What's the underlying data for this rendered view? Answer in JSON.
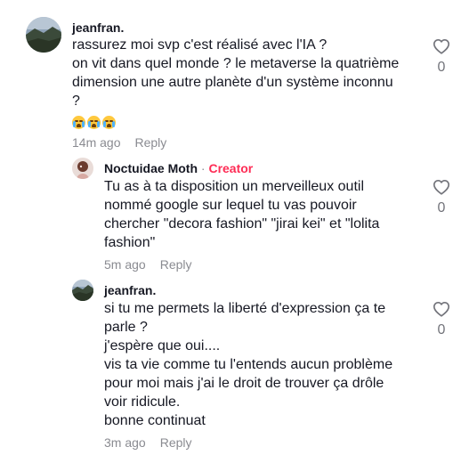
{
  "comments": [
    {
      "username": "jeanfran.",
      "lines": [
        "rassurez moi svp c'est réalisé avec l'IA ?",
        "on vit dans quel monde ? le metaverse la quatrième",
        "dimension une autre planète d'un système inconnu",
        "?"
      ],
      "time": "14m ago",
      "reply_label": "Reply",
      "likes": "0"
    },
    {
      "username": "Noctuidae Moth",
      "separator": " · ",
      "creator_label": "Creator",
      "lines": [
        "Tu as à ta disposition un merveilleux outil",
        "nommé google sur lequel tu vas pouvoir",
        "chercher \"decora fashion\" \"jirai kei\" et \"lolita",
        "fashion\""
      ],
      "time": "5m ago",
      "reply_label": "Reply",
      "likes": "0"
    },
    {
      "username": "jeanfran.",
      "lines": [
        "si tu me permets la liberté d'expression ça te",
        "parle ?",
        "j'espère que oui....",
        "vis ta vie comme tu l'entends aucun problème",
        "pour moi mais j'ai le droit de trouver ça drôle",
        "voir ridicule.",
        "bonne continuat"
      ],
      "time": "3m ago",
      "reply_label": "Reply",
      "likes": "0"
    }
  ],
  "colors": {
    "text": "#161823",
    "muted": "#8a8b91",
    "creator": "#fe2c55"
  },
  "icons": {
    "like": "heart-outline-icon",
    "emoji": "loudly-crying-face-emoji"
  }
}
